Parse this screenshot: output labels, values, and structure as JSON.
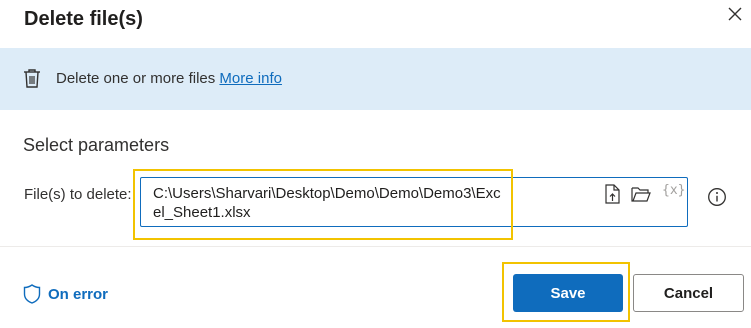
{
  "dialog": {
    "title": "Delete file(s)",
    "close_icon": "close-icon"
  },
  "banner": {
    "icon": "trash-icon",
    "text": "Delete one or more files",
    "link": "More info"
  },
  "parameters": {
    "section_title": "Select parameters",
    "files_label": "File(s) to delete:",
    "files_value": "C:\\Users\\Sharvari\\Desktop\\Demo\\Demo\\Demo3\\Excel_Sheet1.xlsx",
    "variable_token": "{x}",
    "icons": [
      "file-select-icon",
      "folder-open-icon",
      "variable-icon",
      "info-icon"
    ]
  },
  "footer": {
    "on_error_label": "On error",
    "save_label": "Save",
    "cancel_label": "Cancel"
  },
  "colors": {
    "accent": "#0f6cbd",
    "banner_bg": "#ddecf8",
    "highlight": "#f2c300"
  }
}
